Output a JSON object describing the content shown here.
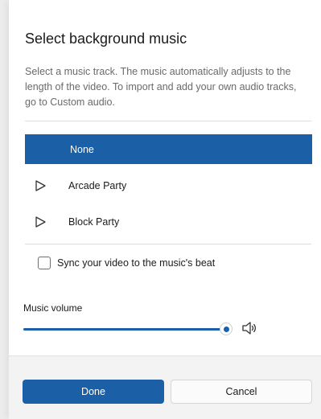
{
  "dialog": {
    "title": "Select background music",
    "description": "Select a music track. The music automatically adjusts to the length of the video. To import and add your own audio tracks, go to Custom audio."
  },
  "tracks": [
    {
      "label": "None",
      "selected": true,
      "icon": null
    },
    {
      "label": "Arcade Party",
      "selected": false,
      "icon": "play-icon"
    },
    {
      "label": "Block Party",
      "selected": false,
      "icon": "play-icon"
    }
  ],
  "sync": {
    "label": "Sync your video to the music's beat",
    "checked": false
  },
  "volume": {
    "label": "Music volume",
    "value": 1.0,
    "icon": "speaker-icon"
  },
  "buttons": {
    "done": "Done",
    "cancel": "Cancel"
  },
  "colors": {
    "accent": "#1b5fa6",
    "background": "#ffffff",
    "footer": "#f3f3f3"
  }
}
